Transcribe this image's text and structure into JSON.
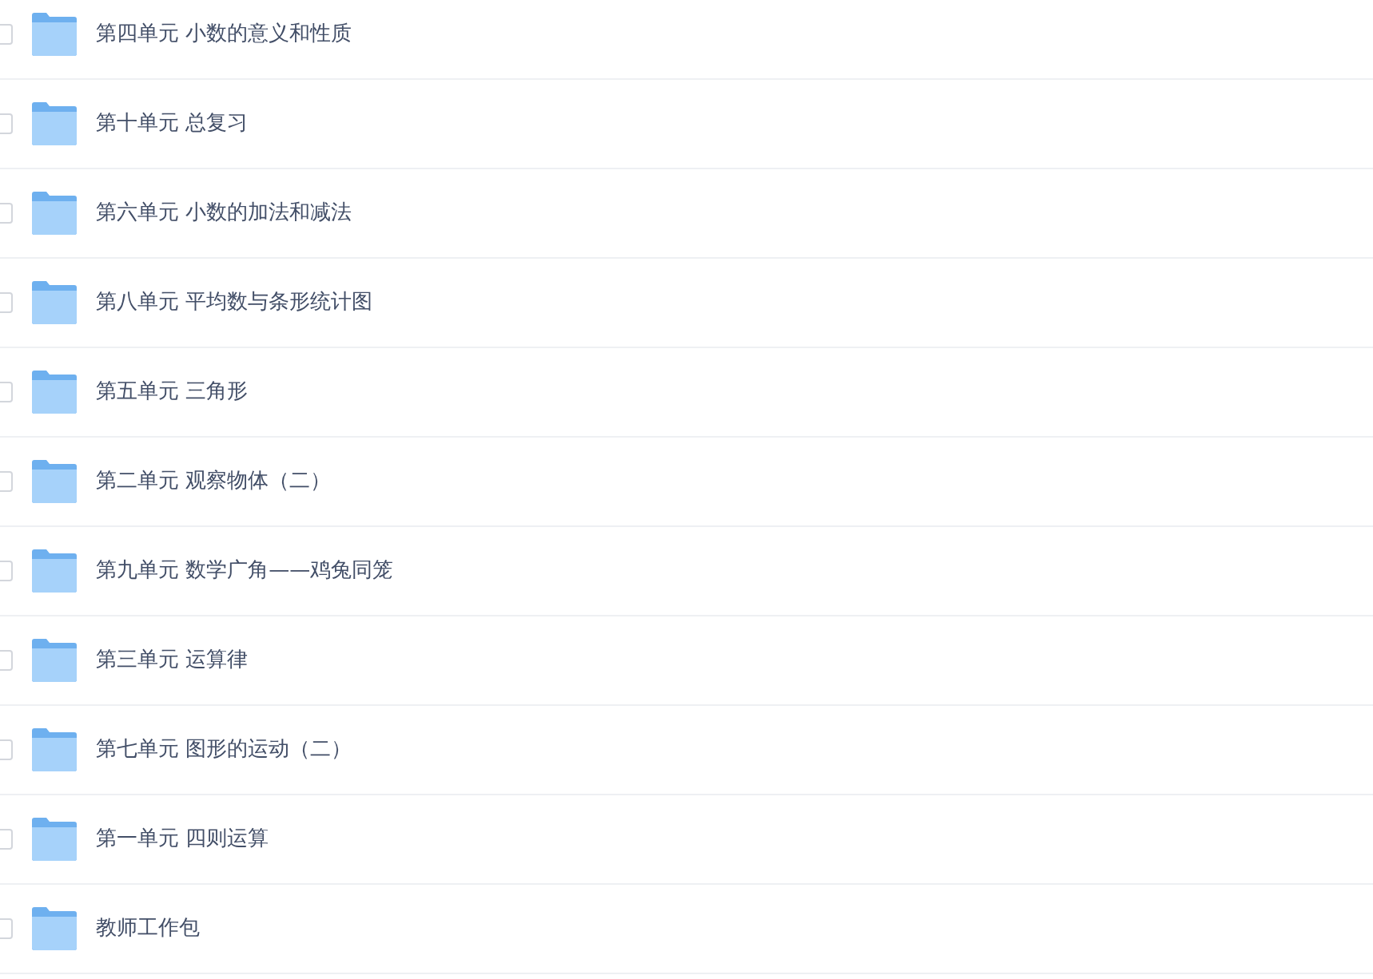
{
  "folders": [
    {
      "name": "第四单元 小数的意义和性质",
      "checked": false
    },
    {
      "name": "第十单元 总复习",
      "checked": false
    },
    {
      "name": "第六单元 小数的加法和减法",
      "checked": false
    },
    {
      "name": "第八单元 平均数与条形统计图",
      "checked": false
    },
    {
      "name": "第五单元 三角形",
      "checked": false
    },
    {
      "name": "第二单元 观察物体（二）",
      "checked": false
    },
    {
      "name": "第九单元 数学广角——鸡兔同笼",
      "checked": false
    },
    {
      "name": "第三单元 运算律",
      "checked": false
    },
    {
      "name": "第七单元 图形的运动（二）",
      "checked": false
    },
    {
      "name": "第一单元 四则运算",
      "checked": false
    },
    {
      "name": "教师工作包",
      "checked": false
    }
  ]
}
